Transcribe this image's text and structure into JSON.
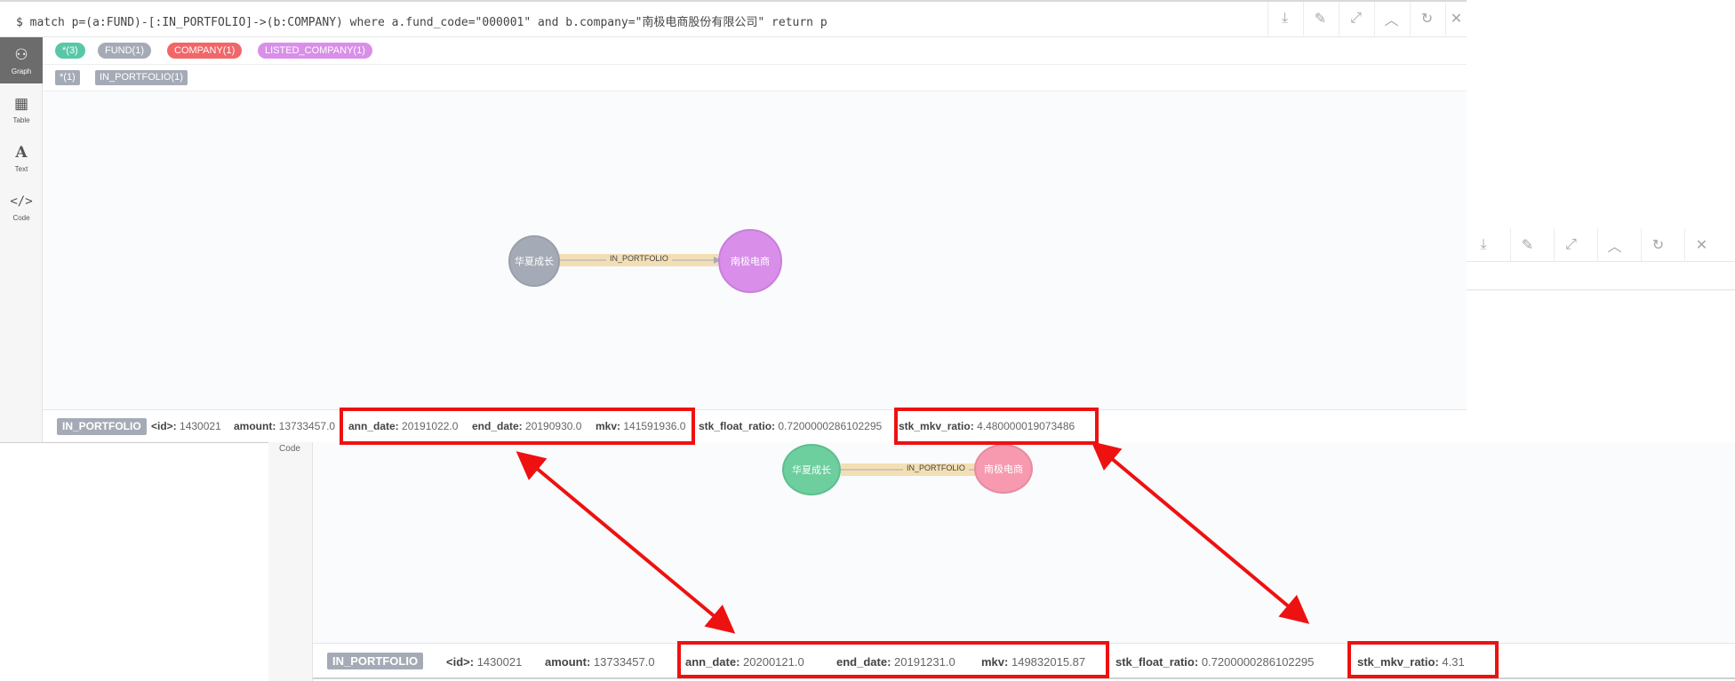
{
  "panel1": {
    "query": "$ match p=(a:FUND)-[:IN_PORTFOLIO]->(b:COMPANY) where a.fund_code=\"000001\" and b.company=\"南极电商股份有限公司\" return p",
    "toolbar_icons": [
      "download-icon",
      "pin-icon",
      "expand-icon",
      "collapse-up-icon",
      "rerun-icon",
      "close-icon"
    ],
    "sidebar": [
      {
        "label": "Graph",
        "icon": "graph-icon"
      },
      {
        "label": "Table",
        "icon": "table-icon"
      },
      {
        "label": "Text",
        "icon": "text-icon"
      },
      {
        "label": "Code",
        "icon": "code-icon"
      }
    ],
    "node_labels": [
      {
        "label": "*(3)",
        "color": "#57c7a8"
      },
      {
        "label": "FUND(1)",
        "color": "#a5abb6"
      },
      {
        "label": "COMPANY(1)",
        "color": "#f16667"
      },
      {
        "label": "LISTED_COMPANY(1)",
        "color": "#d98fe9"
      }
    ],
    "rel_types": [
      "*(1)",
      "IN_PORTFOLIO(1)"
    ],
    "graph": {
      "source": {
        "name": "华夏成长",
        "color": "#a5abb6"
      },
      "target": {
        "name": "南极电商",
        "color": "#d98fe9"
      },
      "edge_label": "IN_PORTFOLIO"
    },
    "status": {
      "type": "IN_PORTFOLIO",
      "props": [
        {
          "key": "<id>:",
          "val": "1430021"
        },
        {
          "key": "amount:",
          "val": "13733457.0"
        },
        {
          "key": "ann_date:",
          "val": "20191022.0"
        },
        {
          "key": "end_date:",
          "val": "20190930.0"
        },
        {
          "key": "mkv:",
          "val": "141591936.0"
        },
        {
          "key": "stk_float_ratio:",
          "val": "0.7200000286102295"
        },
        {
          "key": "stk_mkv_ratio:",
          "val": "4.480000019073486"
        }
      ]
    }
  },
  "panel3": {
    "sidebar_label": "Code",
    "graph": {
      "source": {
        "name": "华夏成长",
        "color": "#6dce9e"
      },
      "target": {
        "name": "南极电商",
        "color": "#f79ab0"
      },
      "edge_label": "IN_PORTFOLIO"
    },
    "status": {
      "type": "IN_PORTFOLIO",
      "props": [
        {
          "key": "<id>:",
          "val": "1430021"
        },
        {
          "key": "amount:",
          "val": "13733457.0"
        },
        {
          "key": "ann_date:",
          "val": "20200121.0"
        },
        {
          "key": "end_date:",
          "val": "20191231.0"
        },
        {
          "key": "mkv:",
          "val": "149832015.87"
        },
        {
          "key": "stk_float_ratio:",
          "val": "0.7200000286102295"
        },
        {
          "key": "stk_mkv_ratio:",
          "val": "4.31"
        }
      ]
    }
  },
  "colors": {
    "highlight": "#ee1111",
    "edge": "#f3dfb5"
  }
}
